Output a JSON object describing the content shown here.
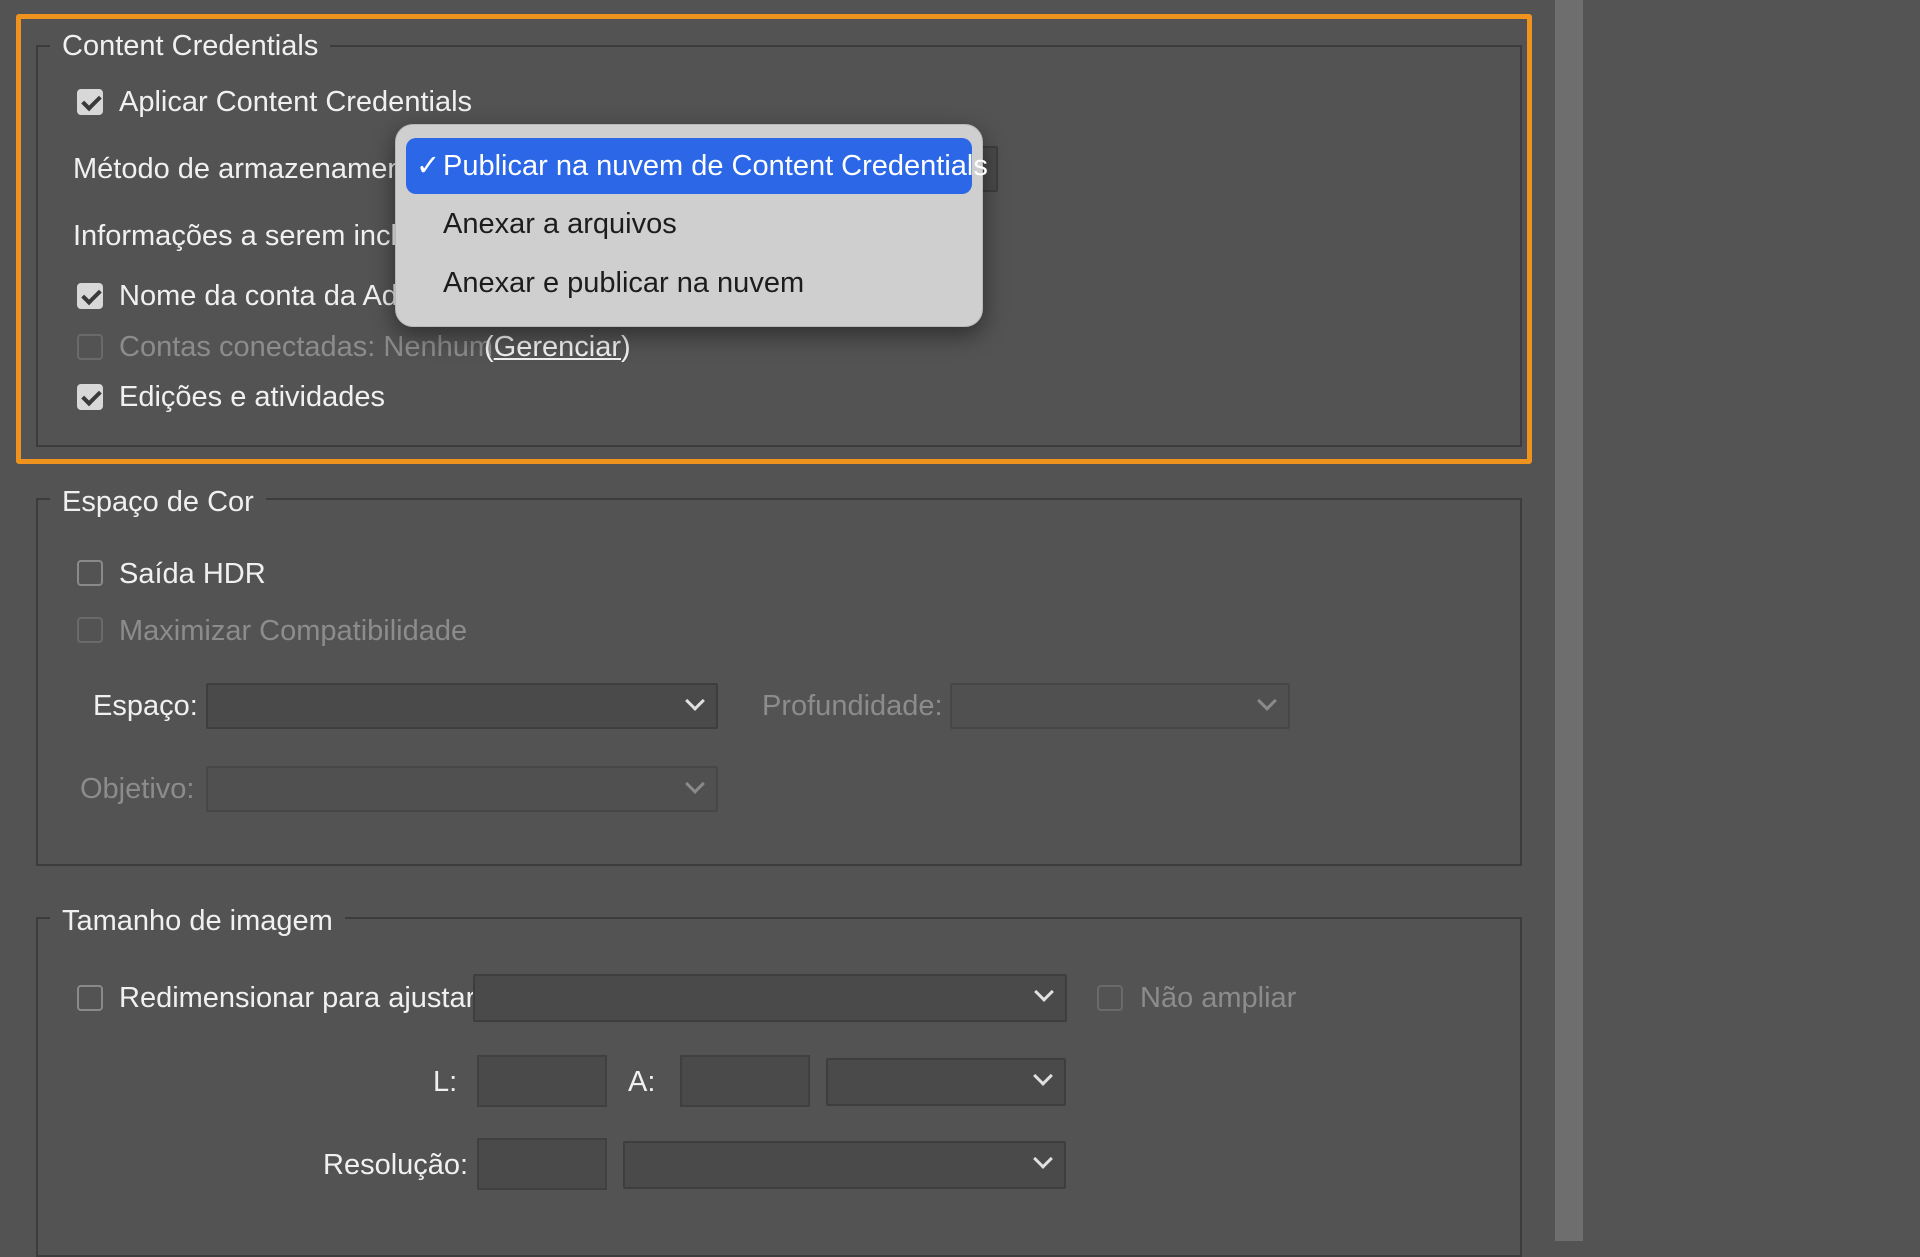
{
  "content_credentials": {
    "title": "Content Credentials",
    "apply_label": "Aplicar Content Credentials",
    "storage_method_label": "Método de armazenamento",
    "info_label": "Informações a serem incluídas",
    "adobe_account_label": "Nome da conta da Adobe",
    "connected_accounts_label": "Contas conectadas: Nenhum",
    "manage_open": "(",
    "manage_label": "Gerenciar",
    "manage_close": ")",
    "edits_label": "Edições e atividades"
  },
  "storage_menu": {
    "options": [
      {
        "label": "Publicar na nuvem de Content Credentials",
        "selected": true
      },
      {
        "label": "Anexar a arquivos",
        "selected": false
      },
      {
        "label": "Anexar e publicar na nuvem",
        "selected": false
      }
    ],
    "check_glyph": "✓"
  },
  "color_space": {
    "title": "Espaço de Cor",
    "hdr_label": "Saída HDR",
    "max_compat_label": "Maximizar Compatibilidade",
    "space_label": "Espaço:",
    "depth_label": "Profundidade:",
    "intent_label": "Objetivo:"
  },
  "image_size": {
    "title": "Tamanho de imagem",
    "resize_label": "Redimensionar para ajustar:",
    "no_enlarge_label": "Não ampliar",
    "width_label": "L:",
    "height_label": "A:",
    "resolution_label": "Resolução:"
  },
  "colors": {
    "highlight": "#f0931e",
    "menu_selected": "#2b67e6",
    "background": "#535353"
  }
}
